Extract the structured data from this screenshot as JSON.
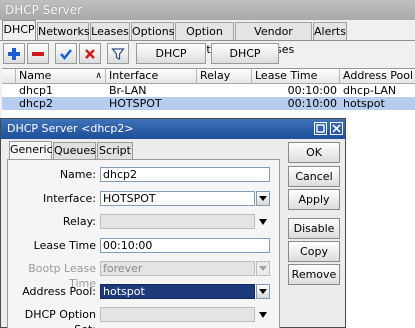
{
  "window": {
    "title": "DHCP Server"
  },
  "tabs": [
    "DHCP",
    "Networks",
    "Leases",
    "Options",
    "Option Sets",
    "Vendor Classes",
    "Alerts"
  ],
  "toolbar": {
    "dhcp_config": "DHCP Config",
    "dhcp_setup": "DHCP Setup",
    "icons": [
      "plus-icon",
      "minus-icon",
      "check-icon",
      "x-icon",
      "filter-icon"
    ]
  },
  "table": {
    "headers": [
      "Name",
      "Interface",
      "Relay",
      "Lease Time",
      "Address Pool"
    ],
    "rows": [
      {
        "name": "dhcp1",
        "interface": "Br-LAN",
        "relay": "",
        "lease_time": "00:10:00",
        "address_pool": "dhcp-LAN"
      },
      {
        "name": "dhcp2",
        "interface": "HOTSPOT",
        "relay": "",
        "lease_time": "00:10:00",
        "address_pool": "hotspot",
        "selected": true
      }
    ]
  },
  "dialog": {
    "title": "DHCP Server <dhcp2>",
    "tabs": [
      "Generic",
      "Queues",
      "Script"
    ],
    "fields": {
      "name": {
        "label": "Name:",
        "value": "dhcp2"
      },
      "interface": {
        "label": "Interface:",
        "value": "HOTSPOT"
      },
      "relay": {
        "label": "Relay:",
        "value": ""
      },
      "lease_time": {
        "label": "Lease Time",
        "value": "00:10:00"
      },
      "bootp_lease_time": {
        "label": "Bootp Lease Time",
        "value": "forever"
      },
      "address_pool": {
        "label": "Address Pool:",
        "value": "hotspot"
      },
      "dhcp_option_set": {
        "label": "DHCP Option Set:",
        "value": ""
      }
    },
    "buttons": {
      "ok": "OK",
      "cancel": "Cancel",
      "apply": "Apply",
      "disable": "Disable",
      "copy": "Copy",
      "remove": "Remove"
    }
  }
}
